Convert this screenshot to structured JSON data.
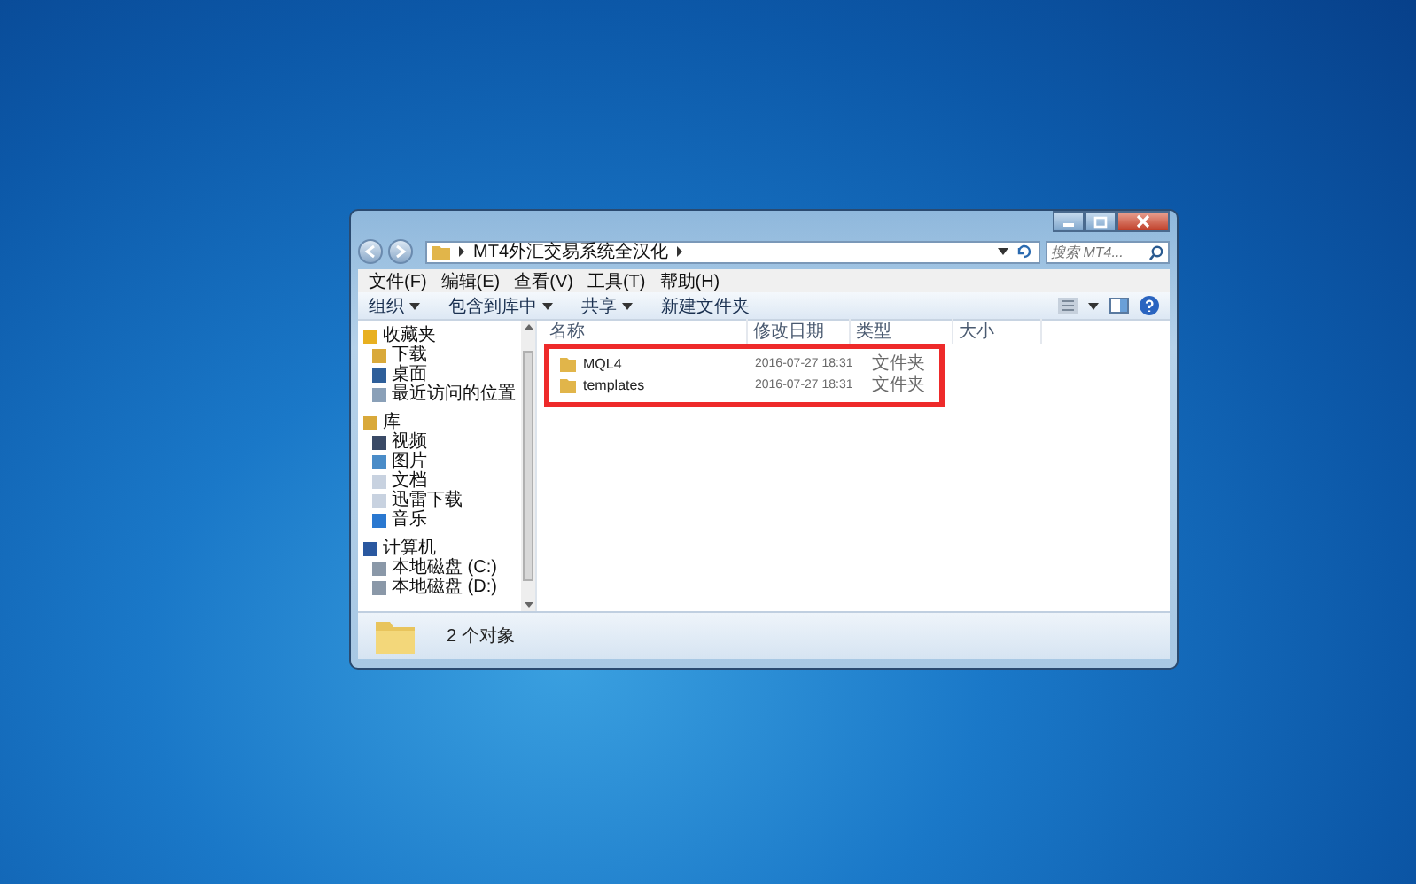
{
  "window": {
    "address_path": "MT4外汇交易系统全汉化",
    "search": {
      "placeholder": "搜索 MT4..."
    }
  },
  "menu": [
    "文件(F)",
    "编辑(E)",
    "查看(V)",
    "工具(T)",
    "帮助(H)"
  ],
  "toolbar": [
    {
      "label": "组织",
      "dropdown": true
    },
    {
      "label": "包含到库中",
      "dropdown": true
    },
    {
      "label": "共享",
      "dropdown": true
    },
    {
      "label": "新建文件夹",
      "dropdown": false
    }
  ],
  "sidebar": {
    "groups": [
      {
        "label": "收藏夹",
        "kind": "star",
        "children": [
          {
            "label": "下载",
            "kind": "folder"
          },
          {
            "label": "桌面",
            "kind": "screen"
          },
          {
            "label": "最近访问的位置",
            "kind": "recent"
          }
        ]
      },
      {
        "label": "库",
        "kind": "library",
        "children": [
          {
            "label": "视频",
            "kind": "film"
          },
          {
            "label": "图片",
            "kind": "picture"
          },
          {
            "label": "文档",
            "kind": "document"
          },
          {
            "label": "迅雷下载",
            "kind": "document"
          },
          {
            "label": "音乐",
            "kind": "music"
          }
        ]
      },
      {
        "label": "计算机",
        "kind": "computer",
        "children": [
          {
            "label": "本地磁盘 (C:)",
            "kind": "drive"
          },
          {
            "label": "本地磁盘 (D:)",
            "kind": "drive"
          }
        ]
      }
    ]
  },
  "table": {
    "columns": [
      "名称",
      "修改日期",
      "类型",
      "大小"
    ],
    "rows": [
      {
        "name": "MQL4",
        "modified": "2016-07-27 18:31",
        "type": "文件夹"
      },
      {
        "name": "templates",
        "modified": "2016-07-27 18:31",
        "type": "文件夹"
      }
    ]
  },
  "status_bar": {
    "text": "2 个对象"
  }
}
